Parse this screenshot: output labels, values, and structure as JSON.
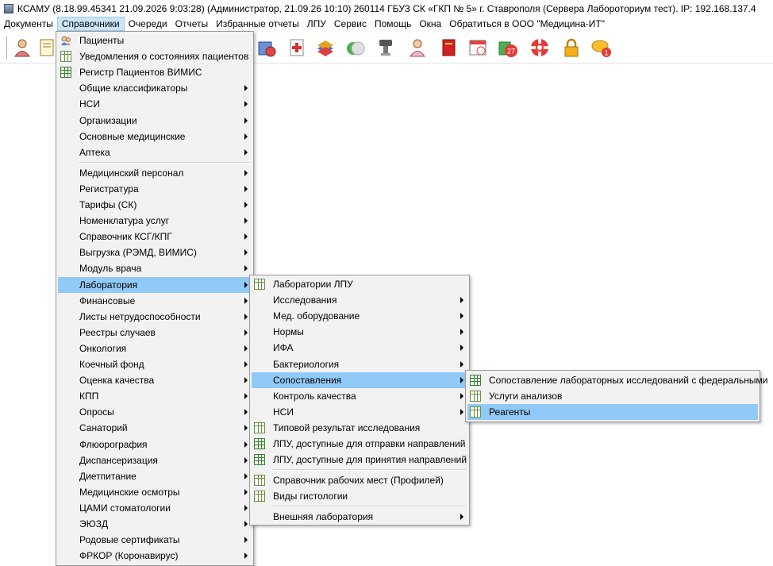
{
  "window": {
    "title": "КСАМУ (8.18.99.45341 21.09.2026 9:03:28) (Администратор, 21.09.26 10:10)  260114 ГБУЗ СК «ГКП № 5» г. Ставрополя (Сервера Лабороториум тест). IP: 192.168.137.4"
  },
  "menubar": [
    {
      "label": "Документы"
    },
    {
      "label": "Справочники",
      "active": true
    },
    {
      "label": "Очереди"
    },
    {
      "label": "Отчеты"
    },
    {
      "label": "Избранные отчеты"
    },
    {
      "label": "ЛПУ"
    },
    {
      "label": "Сервис"
    },
    {
      "label": "Помощь"
    },
    {
      "label": "Окна"
    },
    {
      "label": "Обратиться в ООО \"Медицина-ИТ\""
    }
  ],
  "toolbar": {
    "badges": {
      "calendar": "27",
      "messages": "1"
    }
  },
  "menu1": {
    "items": [
      {
        "label": "Пациенты",
        "icon": "patients-icon"
      },
      {
        "label": "Уведомления о состояниях пациентов",
        "icon": "grid-icon"
      },
      {
        "label": "Регистр Пациентов ВИМИС",
        "icon": "grid-green-icon"
      },
      {
        "label": "Общие классификаторы",
        "submenu": true
      },
      {
        "label": "НСИ",
        "submenu": true
      },
      {
        "label": "Организации",
        "submenu": true
      },
      {
        "label": "Основные медицинские",
        "submenu": true
      },
      {
        "label": "Аптека",
        "submenu": true
      },
      {
        "sep": true
      },
      {
        "label": "Медицинский персонал",
        "submenu": true
      },
      {
        "label": "Регистратура",
        "submenu": true
      },
      {
        "label": "Тарифы (СК)",
        "submenu": true
      },
      {
        "label": "Номенклатура услуг",
        "submenu": true
      },
      {
        "label": "Справочник КСГ/КПГ",
        "submenu": true
      },
      {
        "label": "Выгрузка (РЭМД, ВИМИС)",
        "submenu": true
      },
      {
        "label": "Модуль врача",
        "submenu": true
      },
      {
        "label": "Лаборатория",
        "submenu": true,
        "highlighted": true
      },
      {
        "label": "Финансовые",
        "submenu": true
      },
      {
        "label": "Листы нетрудоспособности",
        "submenu": true
      },
      {
        "label": "Реестры случаев",
        "submenu": true
      },
      {
        "label": "Онкология",
        "submenu": true
      },
      {
        "label": "Коечный фонд",
        "submenu": true
      },
      {
        "label": "Оценка качества",
        "submenu": true
      },
      {
        "label": "КПП",
        "submenu": true
      },
      {
        "label": "Опросы",
        "submenu": true
      },
      {
        "label": "Санаторий",
        "submenu": true
      },
      {
        "label": "Флюорография",
        "submenu": true
      },
      {
        "label": "Диспансеризация",
        "submenu": true
      },
      {
        "label": "Диетпитание",
        "submenu": true
      },
      {
        "label": "Медицинские осмотры",
        "submenu": true
      },
      {
        "label": "ЦАМИ стоматологии",
        "submenu": true
      },
      {
        "label": "ЭЮЗД",
        "submenu": true
      },
      {
        "label": "Родовые сертификаты",
        "submenu": true
      },
      {
        "label": "ФРКОР (Коронавирус)",
        "submenu": true
      }
    ]
  },
  "menu2": {
    "items": [
      {
        "label": "Лаборатории ЛПУ",
        "icon": "grid-icon"
      },
      {
        "label": "Исследования",
        "submenu": true
      },
      {
        "label": "Мед. оборудование",
        "submenu": true
      },
      {
        "label": "Нормы",
        "submenu": true
      },
      {
        "label": "ИФА",
        "submenu": true
      },
      {
        "label": "Бактериология",
        "submenu": true
      },
      {
        "label": "Сопоставления",
        "submenu": true,
        "highlighted": true
      },
      {
        "label": "Контроль качества",
        "submenu": true
      },
      {
        "label": "НСИ",
        "submenu": true
      },
      {
        "label": "Типовой результат исследования",
        "icon": "grid-icon"
      },
      {
        "label": "ЛПУ, доступные для отправки направлений",
        "icon": "grid-green-icon"
      },
      {
        "label": "ЛПУ, доступные для принятия направлений",
        "icon": "grid-green-icon"
      },
      {
        "sep": true
      },
      {
        "label": "Справочник рабочих мест (Профилей)",
        "icon": "grid-icon"
      },
      {
        "label": "Виды гистологии",
        "icon": "grid-icon"
      },
      {
        "sep": true
      },
      {
        "label": "Внешняя лаборатория",
        "submenu": true
      }
    ]
  },
  "menu3": {
    "items": [
      {
        "label": "Сопоставление лабораторных исследований с федеральными",
        "icon": "grid-green-icon"
      },
      {
        "label": "Услуги анализов",
        "icon": "grid-icon"
      },
      {
        "label": "Реагенты",
        "icon": "grid-icon",
        "highlighted": true
      }
    ]
  }
}
